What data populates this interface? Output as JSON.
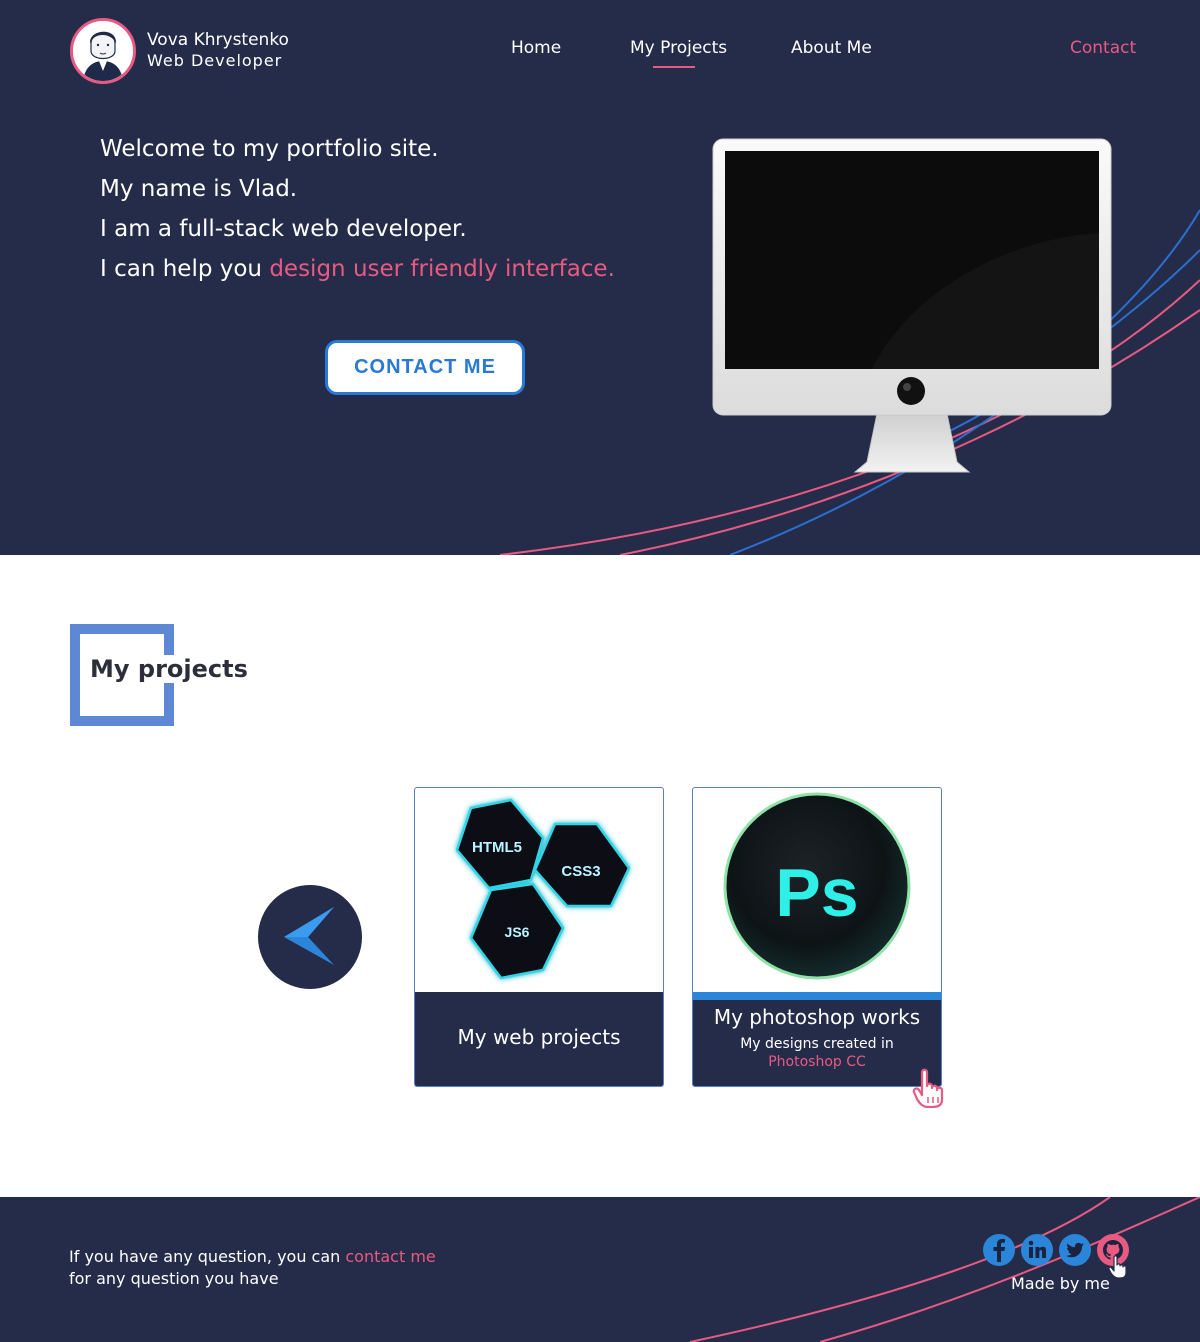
{
  "brand": {
    "name": "Vova Khrystenko",
    "role": "Web Developer"
  },
  "nav": {
    "home": "Home",
    "projects": "My Projects",
    "about": "About Me",
    "contact": "Contact",
    "active": "My Projects"
  },
  "hero": {
    "line1": "Welcome to my portfolio site.",
    "line2": "My name is Vlad.",
    "line3": "I am a full-stack web developer.",
    "line4_prefix": "I can help you ",
    "line4_accent": "design user friendly interface.",
    "cta_label": "CONTACT ME"
  },
  "projects": {
    "section_title": "My projects",
    "cards": [
      {
        "title": "My web projects",
        "image_labels": [
          "HTML5",
          "CSS3",
          "JS6"
        ]
      },
      {
        "title": "My photoshop works",
        "subtitle": "My designs created in",
        "subtitle_accent": "Photoshop CC",
        "image_label": "Ps"
      }
    ]
  },
  "footer": {
    "line1_prefix": "If you have any question, you can ",
    "line1_link": "contact me",
    "line2": "for any question you have",
    "made_by": "Made by me",
    "social": [
      "facebook-icon",
      "linkedin-icon",
      "twitter-icon",
      "github-icon"
    ]
  },
  "colors": {
    "navy": "#252c49",
    "accent_pink": "#e85a82",
    "accent_blue": "#2b86d9",
    "frame_blue": "#5e88d3"
  }
}
